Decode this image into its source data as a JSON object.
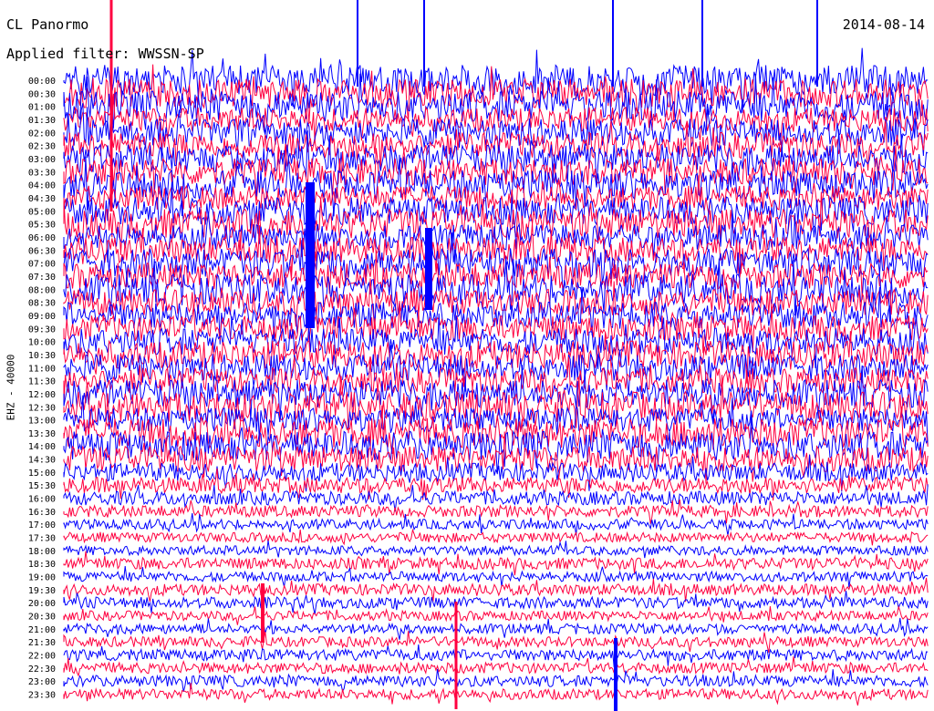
{
  "header": {
    "station": "CL Panormo",
    "date": "2014-08-14",
    "filter": "Applied filter: WWSSN-SP"
  },
  "chart_data": {
    "type": "line",
    "title": "CL Panormo",
    "date": "2014-08-14",
    "ylabel": "EHZ - 40000",
    "row_labels": [
      "00:00",
      "00:30",
      "01:00",
      "01:30",
      "02:00",
      "02:30",
      "03:00",
      "03:30",
      "04:00",
      "04:30",
      "05:00",
      "05:30",
      "06:00",
      "06:30",
      "07:00",
      "07:30",
      "08:00",
      "08:30",
      "09:00",
      "09:30",
      "10:00",
      "10:30",
      "11:00",
      "11:30",
      "12:00",
      "12:30",
      "13:00",
      "13:30",
      "14:00",
      "14:30",
      "15:00",
      "15:30",
      "16:00",
      "16:30",
      "17:00",
      "17:30",
      "18:00",
      "18:30",
      "19:00",
      "19:30",
      "20:00",
      "20:30",
      "21:00",
      "21:30",
      "22:00",
      "22:30",
      "23:00",
      "23:30"
    ],
    "series_colors": [
      "#0000ff",
      "#ff0040"
    ],
    "x_range_minutes": [
      0,
      30
    ],
    "grid": false
  }
}
